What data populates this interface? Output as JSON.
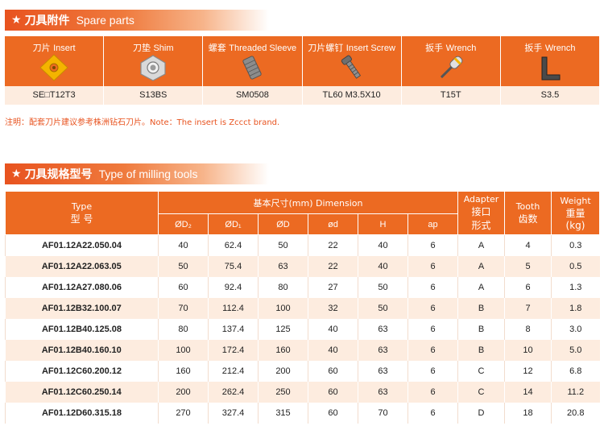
{
  "spare_parts": {
    "heading_cn": "刀具附件",
    "heading_en": "Spare parts",
    "items": [
      {
        "label_cn": "刀片",
        "label_en": "Insert",
        "code": "SE□T12T3",
        "icon": "insert-icon"
      },
      {
        "label_cn": "刀垫",
        "label_en": "Shim",
        "code": "S13BS",
        "icon": "shim-icon"
      },
      {
        "label_cn": "螺套",
        "label_en": "Threaded Sleeve",
        "code": "SM0508",
        "icon": "threaded-sleeve-icon"
      },
      {
        "label_cn": "刀片螺钉",
        "label_en": "Insert Screw",
        "code": "TL60 M3.5X10",
        "icon": "screw-icon"
      },
      {
        "label_cn": "扳手",
        "label_en": "Wrench",
        "code": "T15T",
        "icon": "torx-wrench-icon"
      },
      {
        "label_cn": "扳手",
        "label_en": "Wrench",
        "code": "S3.5",
        "icon": "hex-wrench-icon"
      }
    ]
  },
  "note": "注明：配套刀片建议参考株洲钻石刀片。Note：The insert is Zccct brand.",
  "milling": {
    "heading_cn": "刀具规格型号",
    "heading_en": "Type of milling tools",
    "headers": {
      "type_en": "Type",
      "type_cn": "型 号",
      "dimension": "基本尺寸(mm) Dimension",
      "adapter_en": "Adapter",
      "adapter_cn1": "接口",
      "adapter_cn2": "形式",
      "tooth_en": "Tooth",
      "tooth_cn": "齿数",
      "weight_en": "Weight",
      "weight_cn": "重量",
      "weight_unit": "(kg)",
      "d2": "ØD₂",
      "d1": "ØD₁",
      "d": "ØD",
      "od": "ød",
      "h": "H",
      "ap": "ap"
    },
    "rows": [
      {
        "type": "AF01.12A22.050.04",
        "d2": "40",
        "d1": "62.4",
        "d": "50",
        "od": "22",
        "h": "40",
        "ap": "6",
        "adapter": "A",
        "tooth": "4",
        "weight": "0.3"
      },
      {
        "type": "AF01.12A22.063.05",
        "d2": "50",
        "d1": "75.4",
        "d": "63",
        "od": "22",
        "h": "40",
        "ap": "6",
        "adapter": "A",
        "tooth": "5",
        "weight": "0.5"
      },
      {
        "type": "AF01.12A27.080.06",
        "d2": "60",
        "d1": "92.4",
        "d": "80",
        "od": "27",
        "h": "50",
        "ap": "6",
        "adapter": "A",
        "tooth": "6",
        "weight": "1.3"
      },
      {
        "type": "AF01.12B32.100.07",
        "d2": "70",
        "d1": "112.4",
        "d": "100",
        "od": "32",
        "h": "50",
        "ap": "6",
        "adapter": "B",
        "tooth": "7",
        "weight": "1.8"
      },
      {
        "type": "AF01.12B40.125.08",
        "d2": "80",
        "d1": "137.4",
        "d": "125",
        "od": "40",
        "h": "63",
        "ap": "6",
        "adapter": "B",
        "tooth": "8",
        "weight": "3.0"
      },
      {
        "type": "AF01.12B40.160.10",
        "d2": "100",
        "d1": "172.4",
        "d": "160",
        "od": "40",
        "h": "63",
        "ap": "6",
        "adapter": "B",
        "tooth": "10",
        "weight": "5.0"
      },
      {
        "type": "AF01.12C60.200.12",
        "d2": "160",
        "d1": "212.4",
        "d": "200",
        "od": "60",
        "h": "63",
        "ap": "6",
        "adapter": "C",
        "tooth": "12",
        "weight": "6.8"
      },
      {
        "type": "AF01.12C60.250.14",
        "d2": "200",
        "d1": "262.4",
        "d": "250",
        "od": "60",
        "h": "63",
        "ap": "6",
        "adapter": "C",
        "tooth": "14",
        "weight": "11.2"
      },
      {
        "type": "AF01.12D60.315.18",
        "d2": "270",
        "d1": "327.4",
        "d": "315",
        "od": "60",
        "h": "70",
        "ap": "6",
        "adapter": "D",
        "tooth": "18",
        "weight": "20.8"
      }
    ]
  },
  "colors": {
    "accent": "#ec6a22",
    "row_tint": "#fdecdf",
    "note_text": "#e8531f"
  }
}
